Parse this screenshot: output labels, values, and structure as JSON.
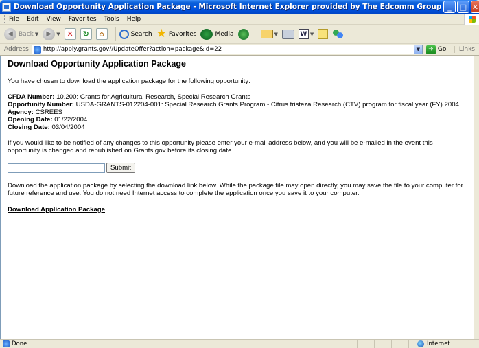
{
  "window": {
    "title": "Download Opportunity Application Package - Microsoft Internet Explorer provided by The Edcomm Group"
  },
  "menu": [
    "File",
    "Edit",
    "View",
    "Favorites",
    "Tools",
    "Help"
  ],
  "toolbar": {
    "back_label": "Back",
    "search_label": "Search",
    "favorites_label": "Favorites",
    "media_label": "Media"
  },
  "address": {
    "label": "Address",
    "url": "http://apply.grants.gov//UpdateOffer?action=package&id=22",
    "go_label": "Go",
    "links_label": "Links"
  },
  "page": {
    "title": "Download Opportunity Application Package",
    "intro": "You have chosen to download the application package for the following opportunity:",
    "cfda_label": "CFDA Number:",
    "cfda_value": " 10.200: Grants for Agricultural Research, Special Research Grants",
    "opportunity_label": "Opportunity Number:",
    "opportunity_value": " USDA-GRANTS-012204-001: Special Research Grants Program - Citrus tristeza Research (CTV) program for fiscal year (FY) 2004",
    "agency_label": "Agency:",
    "agency_value": " CSREES",
    "opening_label": "Opening Date:",
    "opening_value": " 01/22/2004",
    "closing_label": "Closing Date:",
    "closing_value": " 03/04/2004",
    "notify_text": "If you would like to be notified of any changes to this opportunity please enter your e-mail address below, and you will be e-mailed in the event this opportunity is changed and republished on Grants.gov before its closing date.",
    "email_value": "",
    "submit_label": "Submit",
    "download_desc": "Download the application package by selecting the download link below. While the package file may open directly, you may save the file to your computer for future reference and use. You do not need Internet access to complete the application once you save it to your computer.",
    "download_link": "Download Application Package"
  },
  "status": {
    "text": "Done",
    "zone": "Internet"
  }
}
